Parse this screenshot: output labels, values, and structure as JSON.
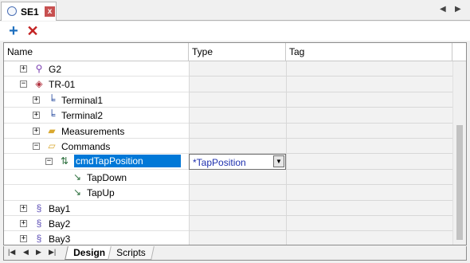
{
  "tab": {
    "title": "SE1",
    "close": "x",
    "nav_prev": "◀",
    "nav_next": "▶"
  },
  "toolbar": {
    "add": "+",
    "delete": "✕"
  },
  "grid": {
    "columns": [
      "Name",
      "Type",
      "Tag"
    ],
    "rows": [
      {
        "label": "G2",
        "type": "",
        "tag": "",
        "icon": "pin-icon",
        "expander": "+",
        "indent": 0
      },
      {
        "label": "TR-01",
        "type": "",
        "tag": "",
        "icon": "transformer-icon",
        "expander": "−",
        "indent": 0
      },
      {
        "label": "Terminal1",
        "type": "",
        "tag": "",
        "icon": "terminal-icon",
        "expander": "+",
        "indent": 1
      },
      {
        "label": "Terminal2",
        "type": "",
        "tag": "",
        "icon": "terminal-icon",
        "expander": "+",
        "indent": 1
      },
      {
        "label": "Measurements",
        "type": "",
        "tag": "",
        "icon": "folder-icon",
        "expander": "+",
        "indent": 1
      },
      {
        "label": "Commands",
        "type": "",
        "tag": "",
        "icon": "folder-open-icon",
        "expander": "−",
        "indent": 1
      },
      {
        "label": "cmdTapPosition",
        "type": "*TapPosition",
        "tag": "",
        "icon": "command-icon",
        "expander": "−",
        "indent": 2,
        "selected": true
      },
      {
        "label": "TapDown",
        "type": "",
        "tag": "",
        "icon": "command-item-icon",
        "expander": "",
        "indent": 3
      },
      {
        "label": "TapUp",
        "type": "",
        "tag": "",
        "icon": "command-item-icon",
        "expander": "",
        "indent": 3
      },
      {
        "label": "Bay1",
        "type": "",
        "tag": "",
        "icon": "bay-icon",
        "expander": "+",
        "indent": 0
      },
      {
        "label": "Bay2",
        "type": "",
        "tag": "",
        "icon": "bay-icon",
        "expander": "+",
        "indent": 0
      },
      {
        "label": "Bay3",
        "type": "",
        "tag": "",
        "icon": "bay-icon",
        "expander": "+",
        "indent": 0
      }
    ]
  },
  "bottom_tabs": [
    "Design",
    "Scripts"
  ],
  "bottom_nav": {
    "first": "|◀",
    "prev": "◀",
    "next": "▶",
    "last": "▶|"
  }
}
